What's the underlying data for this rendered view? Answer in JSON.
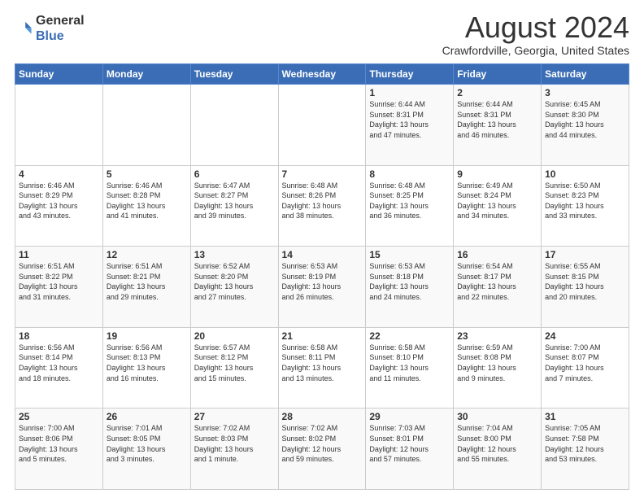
{
  "logo": {
    "general": "General",
    "blue": "Blue"
  },
  "title": "August 2024",
  "location": "Crawfordville, Georgia, United States",
  "days_header": [
    "Sunday",
    "Monday",
    "Tuesday",
    "Wednesday",
    "Thursday",
    "Friday",
    "Saturday"
  ],
  "weeks": [
    [
      {
        "day": "",
        "info": ""
      },
      {
        "day": "",
        "info": ""
      },
      {
        "day": "",
        "info": ""
      },
      {
        "day": "",
        "info": ""
      },
      {
        "day": "1",
        "info": "Sunrise: 6:44 AM\nSunset: 8:31 PM\nDaylight: 13 hours\nand 47 minutes."
      },
      {
        "day": "2",
        "info": "Sunrise: 6:44 AM\nSunset: 8:31 PM\nDaylight: 13 hours\nand 46 minutes."
      },
      {
        "day": "3",
        "info": "Sunrise: 6:45 AM\nSunset: 8:30 PM\nDaylight: 13 hours\nand 44 minutes."
      }
    ],
    [
      {
        "day": "4",
        "info": "Sunrise: 6:46 AM\nSunset: 8:29 PM\nDaylight: 13 hours\nand 43 minutes."
      },
      {
        "day": "5",
        "info": "Sunrise: 6:46 AM\nSunset: 8:28 PM\nDaylight: 13 hours\nand 41 minutes."
      },
      {
        "day": "6",
        "info": "Sunrise: 6:47 AM\nSunset: 8:27 PM\nDaylight: 13 hours\nand 39 minutes."
      },
      {
        "day": "7",
        "info": "Sunrise: 6:48 AM\nSunset: 8:26 PM\nDaylight: 13 hours\nand 38 minutes."
      },
      {
        "day": "8",
        "info": "Sunrise: 6:48 AM\nSunset: 8:25 PM\nDaylight: 13 hours\nand 36 minutes."
      },
      {
        "day": "9",
        "info": "Sunrise: 6:49 AM\nSunset: 8:24 PM\nDaylight: 13 hours\nand 34 minutes."
      },
      {
        "day": "10",
        "info": "Sunrise: 6:50 AM\nSunset: 8:23 PM\nDaylight: 13 hours\nand 33 minutes."
      }
    ],
    [
      {
        "day": "11",
        "info": "Sunrise: 6:51 AM\nSunset: 8:22 PM\nDaylight: 13 hours\nand 31 minutes."
      },
      {
        "day": "12",
        "info": "Sunrise: 6:51 AM\nSunset: 8:21 PM\nDaylight: 13 hours\nand 29 minutes."
      },
      {
        "day": "13",
        "info": "Sunrise: 6:52 AM\nSunset: 8:20 PM\nDaylight: 13 hours\nand 27 minutes."
      },
      {
        "day": "14",
        "info": "Sunrise: 6:53 AM\nSunset: 8:19 PM\nDaylight: 13 hours\nand 26 minutes."
      },
      {
        "day": "15",
        "info": "Sunrise: 6:53 AM\nSunset: 8:18 PM\nDaylight: 13 hours\nand 24 minutes."
      },
      {
        "day": "16",
        "info": "Sunrise: 6:54 AM\nSunset: 8:17 PM\nDaylight: 13 hours\nand 22 minutes."
      },
      {
        "day": "17",
        "info": "Sunrise: 6:55 AM\nSunset: 8:15 PM\nDaylight: 13 hours\nand 20 minutes."
      }
    ],
    [
      {
        "day": "18",
        "info": "Sunrise: 6:56 AM\nSunset: 8:14 PM\nDaylight: 13 hours\nand 18 minutes."
      },
      {
        "day": "19",
        "info": "Sunrise: 6:56 AM\nSunset: 8:13 PM\nDaylight: 13 hours\nand 16 minutes."
      },
      {
        "day": "20",
        "info": "Sunrise: 6:57 AM\nSunset: 8:12 PM\nDaylight: 13 hours\nand 15 minutes."
      },
      {
        "day": "21",
        "info": "Sunrise: 6:58 AM\nSunset: 8:11 PM\nDaylight: 13 hours\nand 13 minutes."
      },
      {
        "day": "22",
        "info": "Sunrise: 6:58 AM\nSunset: 8:10 PM\nDaylight: 13 hours\nand 11 minutes."
      },
      {
        "day": "23",
        "info": "Sunrise: 6:59 AM\nSunset: 8:08 PM\nDaylight: 13 hours\nand 9 minutes."
      },
      {
        "day": "24",
        "info": "Sunrise: 7:00 AM\nSunset: 8:07 PM\nDaylight: 13 hours\nand 7 minutes."
      }
    ],
    [
      {
        "day": "25",
        "info": "Sunrise: 7:00 AM\nSunset: 8:06 PM\nDaylight: 13 hours\nand 5 minutes."
      },
      {
        "day": "26",
        "info": "Sunrise: 7:01 AM\nSunset: 8:05 PM\nDaylight: 13 hours\nand 3 minutes."
      },
      {
        "day": "27",
        "info": "Sunrise: 7:02 AM\nSunset: 8:03 PM\nDaylight: 13 hours\nand 1 minute."
      },
      {
        "day": "28",
        "info": "Sunrise: 7:02 AM\nSunset: 8:02 PM\nDaylight: 12 hours\nand 59 minutes."
      },
      {
        "day": "29",
        "info": "Sunrise: 7:03 AM\nSunset: 8:01 PM\nDaylight: 12 hours\nand 57 minutes."
      },
      {
        "day": "30",
        "info": "Sunrise: 7:04 AM\nSunset: 8:00 PM\nDaylight: 12 hours\nand 55 minutes."
      },
      {
        "day": "31",
        "info": "Sunrise: 7:05 AM\nSunset: 7:58 PM\nDaylight: 12 hours\nand 53 minutes."
      }
    ]
  ]
}
